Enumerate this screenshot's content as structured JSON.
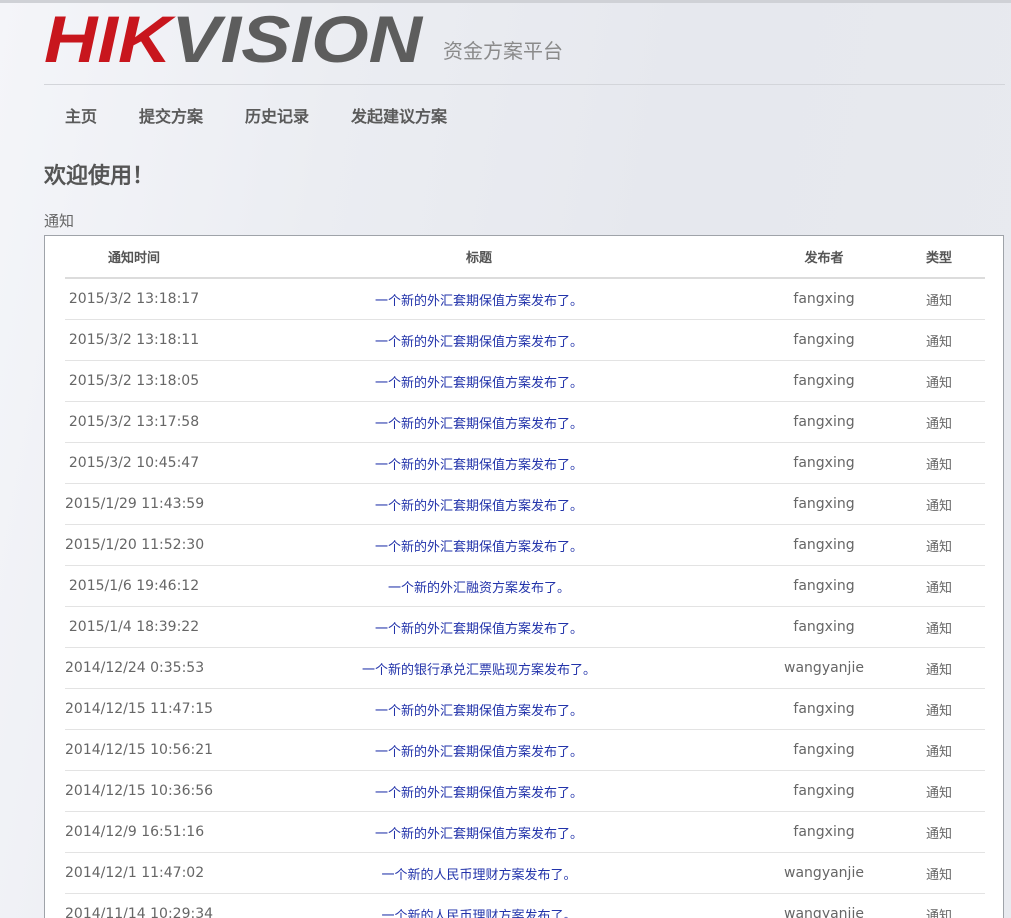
{
  "brand": {
    "logo_text": "HIKVISION",
    "subtitle": "资金方案平台",
    "logo_red": "#c8161d",
    "logo_gray": "#5d5d5d"
  },
  "nav": {
    "items": [
      {
        "label": "主页"
      },
      {
        "label": "提交方案"
      },
      {
        "label": "历史记录"
      },
      {
        "label": "发起建议方案"
      }
    ]
  },
  "main": {
    "welcome": "欢迎使用！",
    "notice_label": "通知"
  },
  "table": {
    "headers": [
      "通知时间",
      "标题",
      "发布者",
      "类型"
    ],
    "rows": [
      {
        "time": "2015/3/2 13:18:17",
        "title": "一个新的外汇套期保值方案发布了。",
        "publisher": "fangxing",
        "type": "通知"
      },
      {
        "time": "2015/3/2 13:18:11",
        "title": "一个新的外汇套期保值方案发布了。",
        "publisher": "fangxing",
        "type": "通知"
      },
      {
        "time": "2015/3/2 13:18:05",
        "title": "一个新的外汇套期保值方案发布了。",
        "publisher": "fangxing",
        "type": "通知"
      },
      {
        "time": "2015/3/2 13:17:58",
        "title": "一个新的外汇套期保值方案发布了。",
        "publisher": "fangxing",
        "type": "通知"
      },
      {
        "time": "2015/3/2 10:45:47",
        "title": "一个新的外汇套期保值方案发布了。",
        "publisher": "fangxing",
        "type": "通知"
      },
      {
        "time": "2015/1/29 11:43:59",
        "title": "一个新的外汇套期保值方案发布了。",
        "publisher": "fangxing",
        "type": "通知"
      },
      {
        "time": "2015/1/20 11:52:30",
        "title": "一个新的外汇套期保值方案发布了。",
        "publisher": "fangxing",
        "type": "通知"
      },
      {
        "time": "2015/1/6 19:46:12",
        "title": "一个新的外汇融资方案发布了。",
        "publisher": "fangxing",
        "type": "通知"
      },
      {
        "time": "2015/1/4 18:39:22",
        "title": "一个新的外汇套期保值方案发布了。",
        "publisher": "fangxing",
        "type": "通知"
      },
      {
        "time": "2014/12/24 0:35:53",
        "title": "一个新的银行承兑汇票贴现方案发布了。",
        "publisher": "wangyanjie",
        "type": "通知"
      },
      {
        "time": "2014/12/15 11:47:15",
        "title": "一个新的外汇套期保值方案发布了。",
        "publisher": "fangxing",
        "type": "通知"
      },
      {
        "time": "2014/12/15 10:56:21",
        "title": "一个新的外汇套期保值方案发布了。",
        "publisher": "fangxing",
        "type": "通知"
      },
      {
        "time": "2014/12/15 10:36:56",
        "title": "一个新的外汇套期保值方案发布了。",
        "publisher": "fangxing",
        "type": "通知"
      },
      {
        "time": "2014/12/9 16:51:16",
        "title": "一个新的外汇套期保值方案发布了。",
        "publisher": "fangxing",
        "type": "通知"
      },
      {
        "time": "2014/12/1 11:47:02",
        "title": "一个新的人民币理财方案发布了。",
        "publisher": "wangyanjie",
        "type": "通知"
      },
      {
        "time": "2014/11/14 10:29:34",
        "title": "一个新的人民币理财方案发布了。",
        "publisher": "wangyanjie",
        "type": "通知"
      }
    ]
  }
}
